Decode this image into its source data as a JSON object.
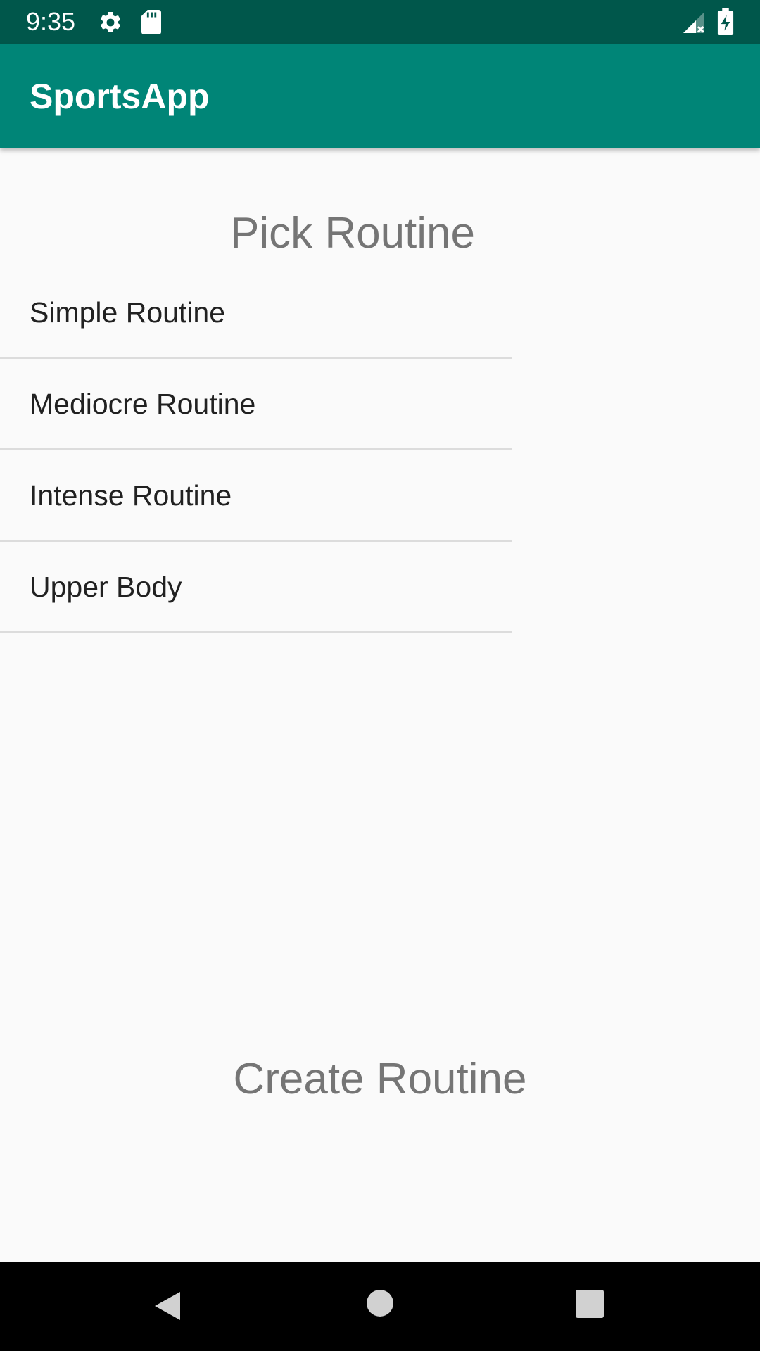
{
  "status_bar": {
    "time": "9:35",
    "icons": [
      "gear-icon",
      "sd-card-icon",
      "signal-icon",
      "battery-charging-icon"
    ]
  },
  "app_bar": {
    "title": "SportsApp"
  },
  "main": {
    "heading": "Pick Routine",
    "routines": [
      {
        "label": "Simple Routine"
      },
      {
        "label": "Mediocre Routine"
      },
      {
        "label": "Intense Routine"
      },
      {
        "label": "Upper Body"
      }
    ],
    "create_label": "Create Routine"
  },
  "nav_bar": {
    "buttons": [
      "back-icon",
      "home-icon",
      "recents-icon"
    ]
  },
  "colors": {
    "status_bar": "#00574b",
    "app_bar": "#008577",
    "background": "#fafafa",
    "heading_text": "#757575",
    "item_text": "#212121",
    "divider": "#dcdcdc"
  }
}
